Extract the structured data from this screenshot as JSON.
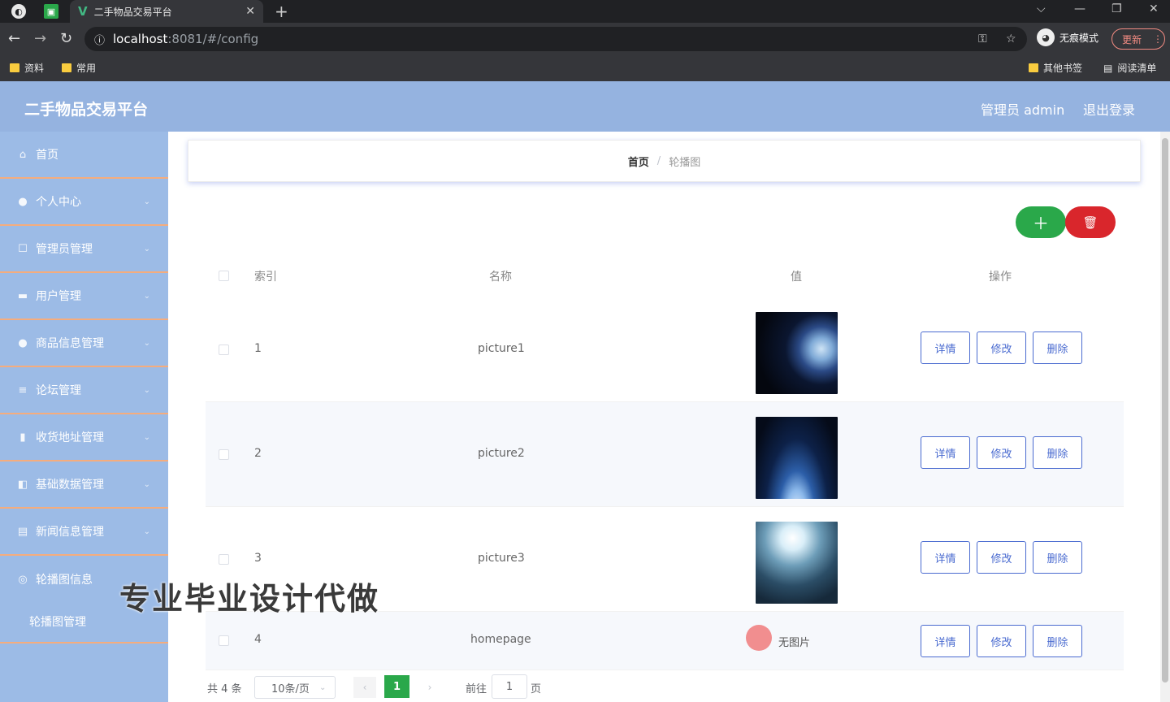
{
  "browser": {
    "tab_title": "二手物品交易平台",
    "url_host": "localhost",
    "url_path": ":8081/#/config",
    "incognito_label": "无痕模式",
    "update_label": "更新",
    "bookmarks": [
      "资料",
      "常用"
    ],
    "bookmarks_right": [
      "其他书签",
      "阅读清单"
    ]
  },
  "header": {
    "title": "二手物品交易平台",
    "user": "管理员 admin",
    "logout": "退出登录"
  },
  "sidebar": {
    "items": [
      {
        "label": "首页",
        "icon": "home-icon"
      },
      {
        "label": "个人中心",
        "icon": "user-icon"
      },
      {
        "label": "管理员管理",
        "icon": "admin-icon"
      },
      {
        "label": "用户管理",
        "icon": "users-icon"
      },
      {
        "label": "商品信息管理",
        "icon": "goods-icon"
      },
      {
        "label": "论坛管理",
        "icon": "forum-icon"
      },
      {
        "label": "收货地址管理",
        "icon": "chart-icon"
      },
      {
        "label": "基础数据管理",
        "icon": "data-icon"
      },
      {
        "label": "新闻信息管理",
        "icon": "news-icon"
      },
      {
        "label": "轮播图信息",
        "icon": "carousel-icon"
      }
    ],
    "sub_item": "轮播图管理"
  },
  "breadcrumb": {
    "home": "首页",
    "separator": "/",
    "current": "轮播图"
  },
  "table": {
    "headers": {
      "index": "索引",
      "name": "名称",
      "value": "值",
      "ops": "操作"
    },
    "rows": [
      {
        "index": "1",
        "name": "picture1",
        "image": "p1"
      },
      {
        "index": "2",
        "name": "picture2",
        "image": "p2"
      },
      {
        "index": "3",
        "name": "picture3",
        "image": "p3"
      },
      {
        "index": "4",
        "name": "homepage",
        "image": "",
        "no_image": "无图片"
      }
    ],
    "ops": {
      "detail": "详情",
      "edit": "修改",
      "delete": "删除"
    }
  },
  "pager": {
    "total": "共 4 条",
    "size": "10条/页",
    "current": "1",
    "goto": "前往",
    "goto_value": "1",
    "unit": "页"
  },
  "watermark": "专业毕业设计代做",
  "colors": {
    "add": "#2aa84a",
    "delete": "#d9262c",
    "header": "#95b3e0",
    "sidebar": "#9cbbe6",
    "accent_border": "#f5ac7d"
  }
}
